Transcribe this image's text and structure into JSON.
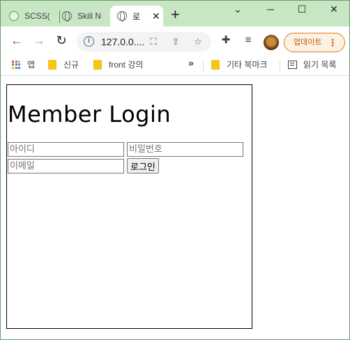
{
  "browser": {
    "tabs": [
      {
        "title": "SCSS(",
        "favicon": "scss-site-icon"
      },
      {
        "title": "Skill N",
        "favicon": "globe-icon"
      },
      {
        "title": "로",
        "favicon": "globe-icon",
        "active": true
      }
    ],
    "new_tab_label": "+",
    "window_controls": {
      "tab_search": "⌄",
      "minimize": "─",
      "maximize": "☐",
      "close": "✕"
    },
    "address": "127.0.0....",
    "update_button": "업데이트",
    "bookmarks": [
      {
        "label": "앱",
        "icon": "apps-icon"
      },
      {
        "label": "신규",
        "icon": "folder-icon"
      },
      {
        "label": "front 강의",
        "icon": "folder-icon"
      }
    ],
    "bookmarks_overflow": "»",
    "other_bookmarks": "기타 북마크",
    "reading_list": "읽기 목록",
    "colors": {
      "tab_strip": "#c9e6c4",
      "update_accent": "#e07b22"
    }
  },
  "page": {
    "heading": "Member Login",
    "id_placeholder": "아이디",
    "password_placeholder": "비밀번호",
    "email_placeholder": "이메일",
    "submit_label": "로그인"
  }
}
